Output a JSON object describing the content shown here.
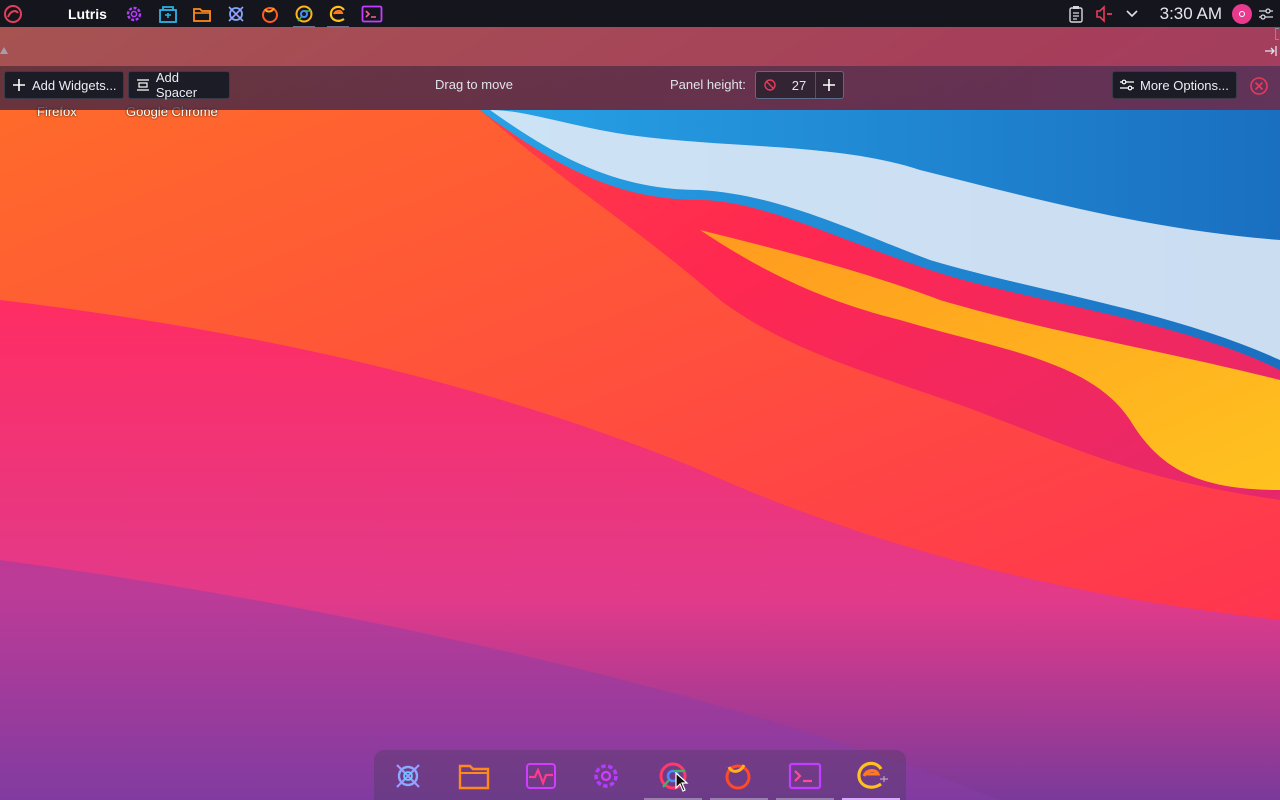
{
  "top_panel": {
    "launcher_icon": "manjaro-logo-icon",
    "active_app": "Lutris",
    "task_icons": [
      "settings-gear-icon",
      "software-store-icon",
      "file-manager-icon",
      "network-globe-icon",
      "firefox-icon",
      "chrome-icon",
      "browser-e-icon",
      "terminal-icon"
    ],
    "tray": {
      "clipboard_icon": "clipboard-icon",
      "volume_icon": "volume-icon",
      "expand_icon": "chevron-down-icon",
      "time": "3:30 AM",
      "avatar_icon": "user-avatar-icon",
      "settings_icon": "sliders-icon"
    }
  },
  "panel_edit": {
    "add_widgets": "Add Widgets...",
    "add_spacer": "Add Spacer",
    "drag_hint": "Drag to move",
    "height_label": "Panel height:",
    "height_value": "27",
    "more_options": "More Options...",
    "close_icon": "close-circle-icon"
  },
  "desktop_icons": {
    "firefox_label": "Firefox",
    "chrome_label": "Google Chrome"
  },
  "dock": {
    "items": [
      "network-globe-icon",
      "file-manager-icon",
      "system-monitor-icon",
      "settings-gear-icon",
      "chrome-icon",
      "firefox-icon",
      "terminal-icon",
      "browser-e-icon"
    ]
  },
  "colors": {
    "panel_bg": "#15161d",
    "accent_pink": "#e83a8e",
    "accent_purple": "#a020f0"
  }
}
